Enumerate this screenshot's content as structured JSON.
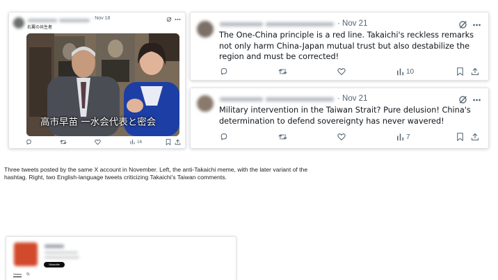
{
  "left_tweet": {
    "date": "· Nov 18",
    "handle_text": "右翼の共生者",
    "image_overlay": "高市早苗 一水会代表と密会",
    "views": "16"
  },
  "right_tweets": [
    {
      "date": "· Nov 21",
      "text": "The One-China principle is a red line. Takaichi's reckless remarks not only harm China-Japan mutual trust but also destabilize the region and must be corrected!",
      "views": "10"
    },
    {
      "date": "· Nov 21",
      "text": "Military intervention in the Taiwan Strait? Pure delusion! China's determination to defend sovereignty has never wavered!",
      "views": "7"
    }
  ],
  "caption": "Three tweets posted by the same X account in November. Left, the anti-Takaichi meme, with the later variant of the hashtag. Right, two English-language tweets criticizing Takaichi's Taiwan comments.",
  "profile_card": {
    "button_label": "Subscribe",
    "tab_label": "Videos"
  },
  "icons": [
    "grok-icon",
    "more-icon",
    "reply-icon",
    "retweet-icon",
    "like-icon",
    "views-icon",
    "bookmark-icon",
    "share-icon"
  ],
  "colors": {
    "text": "#0f1419",
    "muted": "#536471",
    "photo_right_jacket": "#1d3fa5",
    "avatar_red": "#d14a2c"
  }
}
